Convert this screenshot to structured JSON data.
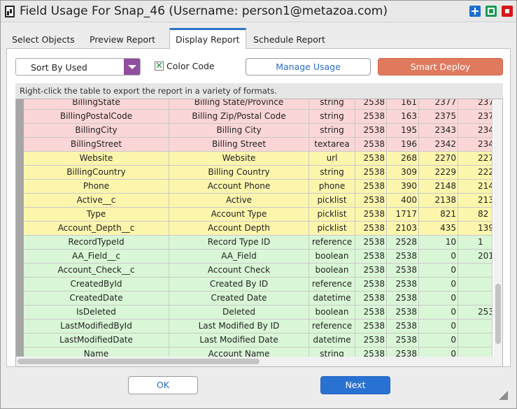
{
  "window": {
    "title": "Field Usage For Snap_46 (Username: person1@metazoa.com)"
  },
  "tabs": [
    "Select Objects",
    "Preview Report",
    "Display Report",
    "Schedule Report"
  ],
  "toolbar": {
    "sort_value": "Sort By Used",
    "color_code_label": "Color Code",
    "color_code_checked": true,
    "manage_usage_label": "Manage Usage",
    "smart_deploy_label": "Smart Deploy"
  },
  "hint": "Right-click the table to export the report in a variety of formats.",
  "colors": {
    "red": "#fbd6d6",
    "yellow": "#fcf6ad",
    "green": "#d9f7d6",
    "accent": "#2f71c9",
    "deploy": "#e07a5f",
    "select_arrow": "#8f4e9f"
  },
  "table": {
    "rows": [
      {
        "status": "red",
        "cells": [
          "BillingState",
          "Billing State/Province",
          "string",
          "2538",
          "161",
          "2377",
          "237"
        ]
      },
      {
        "status": "red",
        "cells": [
          "BillingPostalCode",
          "Billing Zip/Postal Code",
          "string",
          "2538",
          "163",
          "2375",
          "237"
        ]
      },
      {
        "status": "red",
        "cells": [
          "BillingCity",
          "Billing City",
          "string",
          "2538",
          "195",
          "2343",
          "234"
        ]
      },
      {
        "status": "red",
        "cells": [
          "BillingStreet",
          "Billing Street",
          "textarea",
          "2538",
          "196",
          "2342",
          "234"
        ]
      },
      {
        "status": "yellow",
        "cells": [
          "Website",
          "Website",
          "url",
          "2538",
          "268",
          "2270",
          "227"
        ]
      },
      {
        "status": "yellow",
        "cells": [
          "BillingCountry",
          "Billing Country",
          "string",
          "2538",
          "309",
          "2229",
          "222"
        ]
      },
      {
        "status": "yellow",
        "cells": [
          "Phone",
          "Account Phone",
          "phone",
          "2538",
          "390",
          "2148",
          "214"
        ]
      },
      {
        "status": "yellow",
        "cells": [
          "Active__c",
          "Active",
          "picklist",
          "2538",
          "400",
          "2138",
          "213"
        ]
      },
      {
        "status": "yellow",
        "cells": [
          "Type",
          "Account Type",
          "picklist",
          "2538",
          "1717",
          "821",
          "82"
        ]
      },
      {
        "status": "yellow",
        "cells": [
          "Account_Depth__c",
          "Account Depth",
          "picklist",
          "2538",
          "2103",
          "435",
          "139"
        ]
      },
      {
        "status": "green",
        "cells": [
          "RecordTypeId",
          "Record Type ID",
          "reference",
          "2538",
          "2528",
          "10",
          "1"
        ]
      },
      {
        "status": "green",
        "cells": [
          "AA_Field__c",
          "AA_Field",
          "boolean",
          "2538",
          "2538",
          "0",
          "201"
        ]
      },
      {
        "status": "green",
        "cells": [
          "Account_Check__c",
          "Account Check",
          "boolean",
          "2538",
          "2538",
          "0",
          ""
        ]
      },
      {
        "status": "green",
        "cells": [
          "CreatedById",
          "Created By ID",
          "reference",
          "2538",
          "2538",
          "0",
          ""
        ]
      },
      {
        "status": "green",
        "cells": [
          "CreatedDate",
          "Created Date",
          "datetime",
          "2538",
          "2538",
          "0",
          ""
        ]
      },
      {
        "status": "green",
        "cells": [
          "IsDeleted",
          "Deleted",
          "boolean",
          "2538",
          "2538",
          "0",
          "253"
        ]
      },
      {
        "status": "green",
        "cells": [
          "LastModifiedById",
          "Last Modified By ID",
          "reference",
          "2538",
          "2538",
          "0",
          ""
        ]
      },
      {
        "status": "green",
        "cells": [
          "LastModifiedDate",
          "Last Modified Date",
          "datetime",
          "2538",
          "2538",
          "0",
          ""
        ]
      },
      {
        "status": "green",
        "cells": [
          "Name",
          "Account Name",
          "string",
          "2538",
          "2538",
          "0",
          ""
        ]
      }
    ]
  },
  "buttons": {
    "ok": "OK",
    "next": "Next"
  },
  "active_tab": "Display Report"
}
